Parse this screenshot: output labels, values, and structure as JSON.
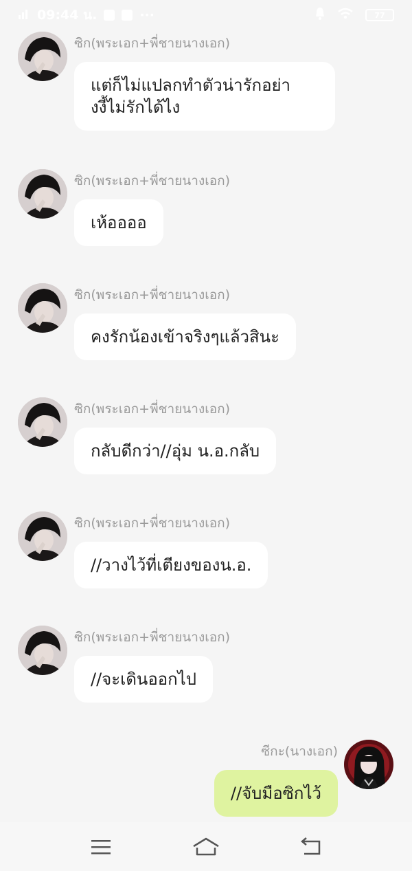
{
  "status_bar": {
    "time": "09:44 น.",
    "battery": "77",
    "more": "···"
  },
  "contacts": {
    "other_name": "ซิก(พระเอก+พี่ชายนางเอก)",
    "self_name": "ซีกะ(นางเอก)"
  },
  "messages": [
    {
      "text_lines": [
        "แต่ก็ไม่แปลกทำตัวน่ารักอย่า",
        "งงี้ไม่รักได้ไง"
      ]
    },
    {
      "text": "เห้ออออ"
    },
    {
      "text": "คงรักน้องเข้าจริงๆแล้วสินะ"
    },
    {
      "text": "กลับดีกว่า//อุ่ม น.อ.กลับ"
    },
    {
      "text": "//วางไว้ที่เตียงของน.อ."
    },
    {
      "text": "//จะเดินออกไป"
    },
    {
      "text": "//จับมือซิกไว้"
    }
  ],
  "icons": {
    "nav_menu": "menu-icon",
    "nav_home": "home-icon",
    "nav_back": "back-icon"
  },
  "colors": {
    "background": "#f5f5f5",
    "bubble_other": "#ffffff",
    "bubble_self": "#dff3a0",
    "sender_text": "#9a9a9a"
  }
}
